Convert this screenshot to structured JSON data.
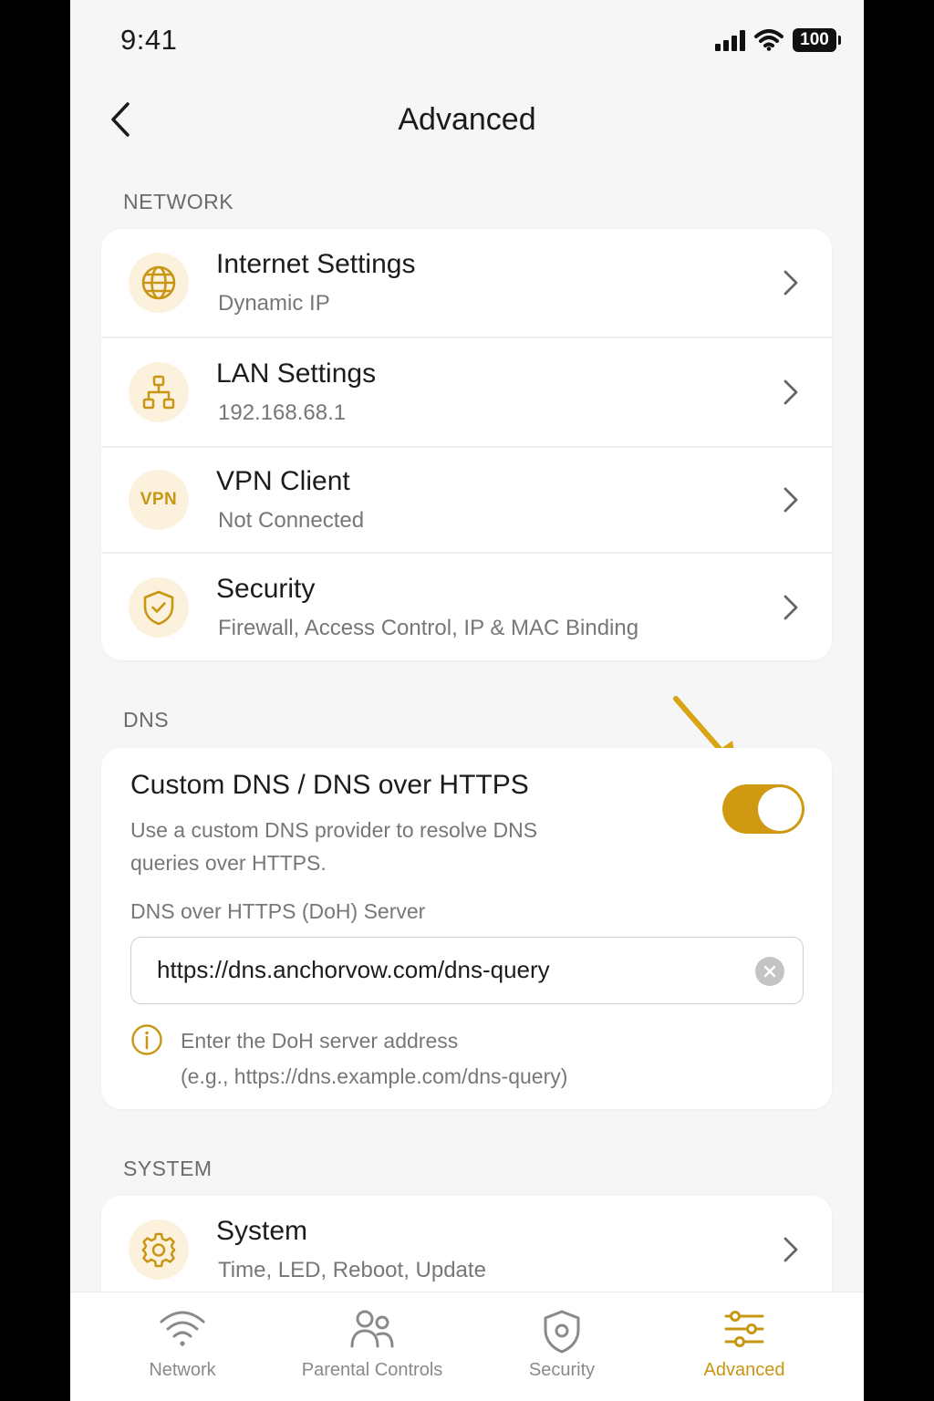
{
  "status_bar": {
    "time": "9:41",
    "battery": "100"
  },
  "header": {
    "title": "Advanced"
  },
  "sections": {
    "network": "NETWORK",
    "dns": "DNS",
    "system": "SYSTEM"
  },
  "network_items": [
    {
      "title": "Internet Settings",
      "subtitle": "Dynamic IP",
      "icon": "globe-icon"
    },
    {
      "title": "LAN Settings",
      "subtitle": "192.168.68.1",
      "icon": "lan-topology-icon"
    },
    {
      "title": "VPN Client",
      "subtitle": "Not Connected",
      "icon": "vpn-icon",
      "icon_text": "VPN"
    },
    {
      "title": "Security",
      "subtitle": "Firewall, Access Control, IP & MAC Binding",
      "icon": "shield-check-icon"
    }
  ],
  "dns": {
    "title": "Custom DNS / DNS over HTTPS",
    "description": "Use a custom DNS provider to resolve DNS queries over HTTPS.",
    "toggle_on": true,
    "field_label": "DNS over HTTPS (DoH) Server",
    "field_value": "https://dns.anchorvow.com/dns-query",
    "hint_line1": "Enter the DoH server address",
    "hint_line2": "(e.g., https://dns.example.com/dns-query)"
  },
  "system_items": [
    {
      "title": "System",
      "subtitle": "Time, LED, Reboot, Update",
      "icon": "gear-icon"
    }
  ],
  "bottom_nav": [
    {
      "label": "Network",
      "icon": "wifi-icon",
      "active": false
    },
    {
      "label": "Parental Controls",
      "icon": "users-icon",
      "active": false
    },
    {
      "label": "Security",
      "icon": "shield-icon",
      "active": false
    },
    {
      "label": "Advanced",
      "icon": "sliders-icon",
      "active": true
    }
  ],
  "colors": {
    "accent": "#cf9a12",
    "icon_bg": "#fbf1dc",
    "background": "#f6f6f7"
  }
}
